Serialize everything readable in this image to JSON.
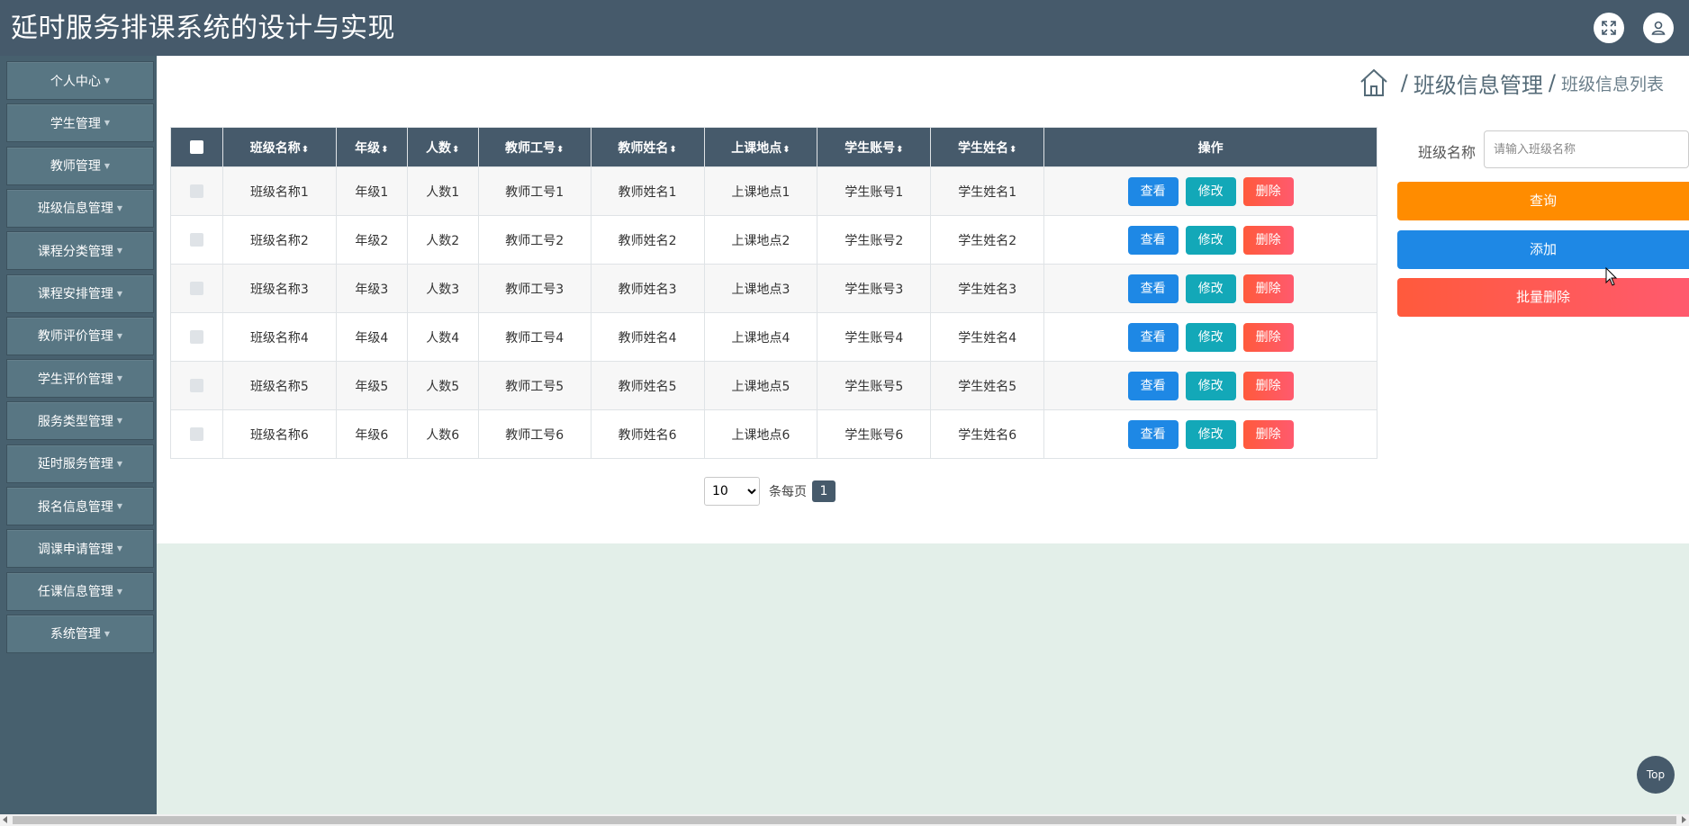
{
  "app": {
    "title": "延时服务排课系统的设计与实现"
  },
  "header_icons": [
    {
      "name": "fullscreen-icon"
    },
    {
      "name": "user-icon"
    }
  ],
  "sidebar": {
    "items": [
      {
        "label": "个人中心"
      },
      {
        "label": "学生管理"
      },
      {
        "label": "教师管理"
      },
      {
        "label": "班级信息管理"
      },
      {
        "label": "课程分类管理"
      },
      {
        "label": "课程安排管理"
      },
      {
        "label": "教师评价管理"
      },
      {
        "label": "学生评价管理"
      },
      {
        "label": "服务类型管理"
      },
      {
        "label": "延时服务管理"
      },
      {
        "label": "报名信息管理"
      },
      {
        "label": "调课申请管理"
      },
      {
        "label": "任课信息管理"
      },
      {
        "label": "系统管理"
      }
    ]
  },
  "breadcrumb": {
    "level1": "班级信息管理",
    "level2": "班级信息列表",
    "separator": "/"
  },
  "table": {
    "columns": [
      "班级名称",
      "年级",
      "人数",
      "教师工号",
      "教师姓名",
      "上课地点",
      "学生账号",
      "学生姓名",
      "操作"
    ],
    "sort_glyph": "⬍",
    "rows": [
      [
        "班级名称1",
        "年级1",
        "人数1",
        "教师工号1",
        "教师姓名1",
        "上课地点1",
        "学生账号1",
        "学生姓名1"
      ],
      [
        "班级名称2",
        "年级2",
        "人数2",
        "教师工号2",
        "教师姓名2",
        "上课地点2",
        "学生账号2",
        "学生姓名2"
      ],
      [
        "班级名称3",
        "年级3",
        "人数3",
        "教师工号3",
        "教师姓名3",
        "上课地点3",
        "学生账号3",
        "学生姓名3"
      ],
      [
        "班级名称4",
        "年级4",
        "人数4",
        "教师工号4",
        "教师姓名4",
        "上课地点4",
        "学生账号4",
        "学生姓名4"
      ],
      [
        "班级名称5",
        "年级5",
        "人数5",
        "教师工号5",
        "教师姓名5",
        "上课地点5",
        "学生账号5",
        "学生姓名5"
      ],
      [
        "班级名称6",
        "年级6",
        "人数6",
        "教师工号6",
        "教师姓名6",
        "上课地点6",
        "学生账号6",
        "学生姓名6"
      ]
    ],
    "actions": {
      "view": "查看",
      "edit": "修改",
      "delete": "删除"
    }
  },
  "pagination": {
    "page_size": "10",
    "page_size_options": [
      "10"
    ],
    "per_page_label": "条每页",
    "current_page": "1"
  },
  "search": {
    "label": "班级名称",
    "placeholder": "请输入班级名称",
    "query_button": "查询",
    "add_button": "添加",
    "batch_delete_button": "批量删除"
  },
  "back_to_top": "Top",
  "colors": {
    "header_bg": "#465a6b",
    "sidebar_bg": "#47606e",
    "nav_item_bg": "#587683",
    "query_orange": "#ff8c00",
    "primary_blue": "#1e88e5",
    "teal": "#13a8b8",
    "danger_red": "#ff5656",
    "content_bg": "#e3efe9"
  }
}
